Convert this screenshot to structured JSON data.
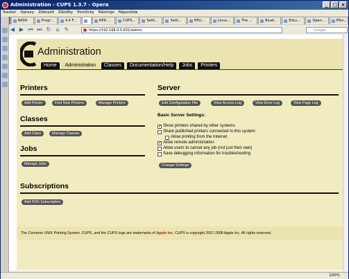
{
  "window": {
    "title": "Administration - CUPS 1.3.7 - Opera"
  },
  "menu": [
    "Soubor",
    "Úpravy",
    "Zobrazit",
    "Záložky",
    "Pomůcky",
    "Nástroje",
    "Nápověda"
  ],
  "browser_tabs": [
    "BASH",
    "Progr...",
    "4.4 F...",
    "",
    "RPD ...",
    "CUPS...",
    "Setti...",
    "Setti...",
    "HPLI...",
    "Linux...",
    "The ...",
    "Bluet...",
    "Esku...",
    "Open...",
    "Přen..."
  ],
  "address": "https://192.168.0.5:631/admin",
  "search_placeholder": "Google",
  "page": {
    "title": "Administration",
    "tabs": [
      "Home",
      "Administration",
      "Classes",
      "Documentation/Help",
      "Jobs",
      "Printers"
    ],
    "selected_tab": "Administration"
  },
  "printers": {
    "heading": "Printers",
    "buttons": [
      "Add Printer",
      "Find New Printers",
      "Manage Printers"
    ]
  },
  "classes": {
    "heading": "Classes",
    "buttons": [
      "Add Class",
      "Manage Classes"
    ]
  },
  "jobs": {
    "heading": "Jobs",
    "buttons": [
      "Manage Jobs"
    ]
  },
  "subscriptions": {
    "heading": "Subscriptions",
    "buttons": [
      "Add RSS Subscription"
    ]
  },
  "server": {
    "heading": "Server",
    "buttons": [
      "Edit Configuration File",
      "View Access Log",
      "View Error Log",
      "View Page Log"
    ],
    "settings_heading": "Basic Server Settings:",
    "options": [
      {
        "label": "Show printers shared by other systems",
        "checked": true
      },
      {
        "label": "Share published printers connected to this system",
        "checked": false
      },
      {
        "label": "Allow printing from the Internet",
        "checked": false
      },
      {
        "label": "Allow remote administration",
        "checked": true
      },
      {
        "label": "Allow users to cancel any job (not just their own)",
        "checked": false
      },
      {
        "label": "Save debugging information for troubleshooting",
        "checked": false
      }
    ],
    "change_button": "Change Settings"
  },
  "footer": {
    "text_before": "The Common UNIX Printing System, CUPS, and the CUPS logo are trademarks of ",
    "apple": "Apple Inc.",
    "text_after": " CUPS is copyright 2007-2008 Apple Inc. All rights reserved."
  },
  "status": {
    "zoom": "100%"
  }
}
